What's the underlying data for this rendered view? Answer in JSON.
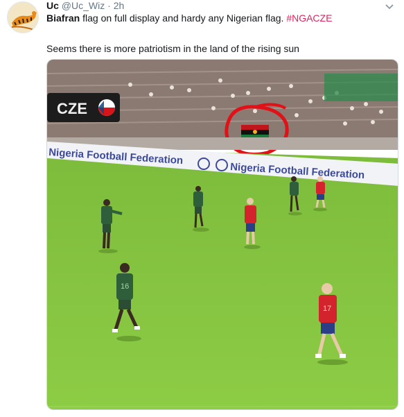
{
  "tweet": {
    "display_name": "Uc",
    "handle": "@Uc_Wiz",
    "separator": "·",
    "time": "2h",
    "text_bold": "Biafran",
    "text_rest": " flag on full display and hardy any Nigerian flag. ",
    "hashtag": "#NGACZE",
    "text_line2": "Seems there is more patriotism in the land of the rising sun"
  },
  "media": {
    "scoreboard_text": "CZE",
    "banner_text_1": "Nigeria Football Federation",
    "banner_text_2": "Nigeria Football Federation",
    "player_numbers": [
      "16",
      "17"
    ]
  },
  "icons": {
    "avatar": "tiger-avatar-icon",
    "caret": "chevron-down-icon",
    "highlight": "red-circle-annotation"
  },
  "colors": {
    "hashtag": "#e0245e",
    "secondary_text": "#657786",
    "pitch": "#86c53f",
    "annotation": "#e01218"
  }
}
